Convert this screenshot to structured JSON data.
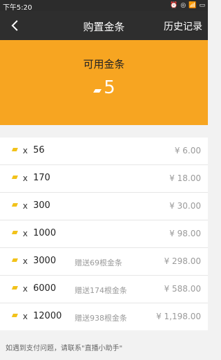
{
  "status_bar": {
    "time": "下午5:20",
    "icons": [
      "alarm-icon",
      "headset-icon",
      "wifi-icon",
      "battery-icon"
    ]
  },
  "header": {
    "title": "购置金条",
    "history_label": "历史记录"
  },
  "balance": {
    "label": "可用金条",
    "value": "5"
  },
  "items": [
    {
      "x": "x",
      "qty": "56",
      "bonus": "",
      "price": "¥  6.00"
    },
    {
      "x": "x",
      "qty": "170",
      "bonus": "",
      "price": "¥  18.00"
    },
    {
      "x": "x",
      "qty": "300",
      "bonus": "",
      "price": "¥  30.00"
    },
    {
      "x": "x",
      "qty": "1000",
      "bonus": "",
      "price": "¥  98.00"
    },
    {
      "x": "x",
      "qty": "3000",
      "bonus": "赠送69根金条",
      "price": "¥  298.00"
    },
    {
      "x": "x",
      "qty": "6000",
      "bonus": "赠送174根金条",
      "price": "¥  588.00"
    },
    {
      "x": "x",
      "qty": "12000",
      "bonus": "赠送938根金条",
      "price": "¥  1,198.00"
    }
  ],
  "footer": {
    "text": "如遇到支付问题，请联系\"直播小助手\""
  },
  "colors": {
    "accent": "#f7a521",
    "nav": "#2e2e2e",
    "gold_icon": "#f2c21a"
  }
}
